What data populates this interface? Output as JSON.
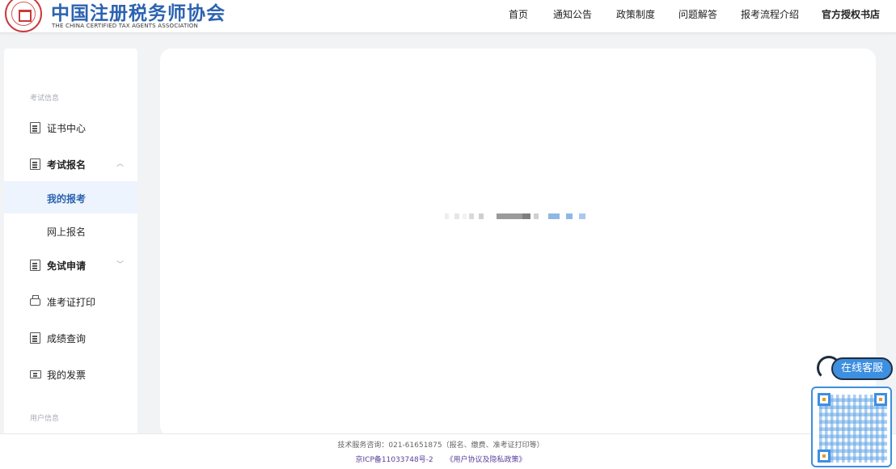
{
  "header": {
    "title": "中国注册税务师协会",
    "subtitle": "THE CHINA CERTIFIED TAX AGENTS ASSOCIATION",
    "nav": [
      {
        "label": "首页"
      },
      {
        "label": "通知公告"
      },
      {
        "label": "政策制度"
      },
      {
        "label": "问题解答"
      },
      {
        "label": "报考流程介绍"
      },
      {
        "label": "官方授权书店"
      }
    ]
  },
  "sidebar": {
    "section_exam": "考试信息",
    "items": {
      "certificate": "证书中心",
      "registration": "考试报名",
      "my_registration": "我的报考",
      "online_registration": "网上报名",
      "exemption": "免试申请",
      "admission_print": "准考证打印",
      "score_query": "成绩查询",
      "my_invoice": "我的发票"
    },
    "section_user": "用户信息"
  },
  "main": {
    "status": "loading"
  },
  "footer": {
    "support": "技术服务咨询：021-61651875（报名、缴费、准考证打印等）",
    "icp": "京ICP备11033748号-2",
    "policy": "《用户协议及隐私政策》"
  },
  "service": {
    "label": "在线客服"
  },
  "colors": {
    "brand": "#2c63b0",
    "active_bg": "#eef4fd",
    "service_blue": "#3d8fe0"
  }
}
